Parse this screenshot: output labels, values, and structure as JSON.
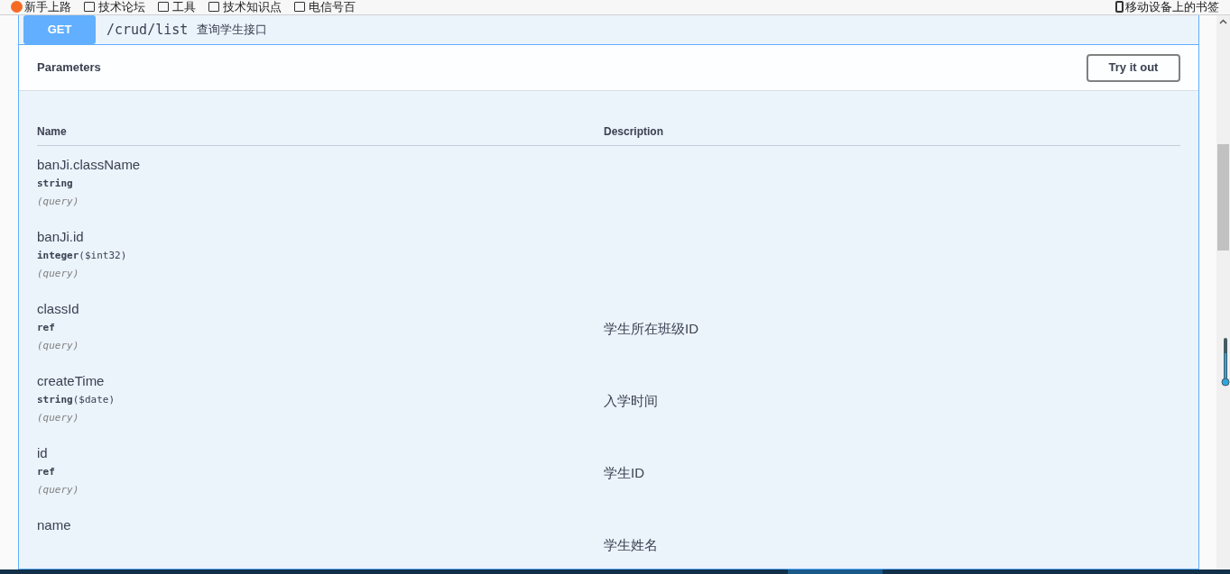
{
  "bookmarks": {
    "items": [
      "新手上路",
      "技术论坛",
      "工具",
      "技术知识点",
      "电信号百"
    ],
    "mobile": "移动设备上的书签"
  },
  "operation": {
    "method": "GET",
    "path": "/crud/list",
    "summary": "查询学生接口"
  },
  "parameters": {
    "title": "Parameters",
    "button": "Try it out",
    "columns": [
      "Name",
      "Description"
    ],
    "rows": [
      {
        "name": "banJi.className",
        "type": "string",
        "format": "",
        "in": "(query)",
        "description": ""
      },
      {
        "name": "banJi.id",
        "type": "integer",
        "format": "($int32)",
        "in": "(query)",
        "description": ""
      },
      {
        "name": "classId",
        "type": "ref",
        "format": "",
        "in": "(query)",
        "description": "学生所在班级ID"
      },
      {
        "name": "createTime",
        "type": "string",
        "format": "($date)",
        "in": "(query)",
        "description": "入学时间"
      },
      {
        "name": "id",
        "type": "ref",
        "format": "",
        "in": "(query)",
        "description": "学生ID"
      },
      {
        "name": "name",
        "description": "学生姓名"
      }
    ]
  }
}
